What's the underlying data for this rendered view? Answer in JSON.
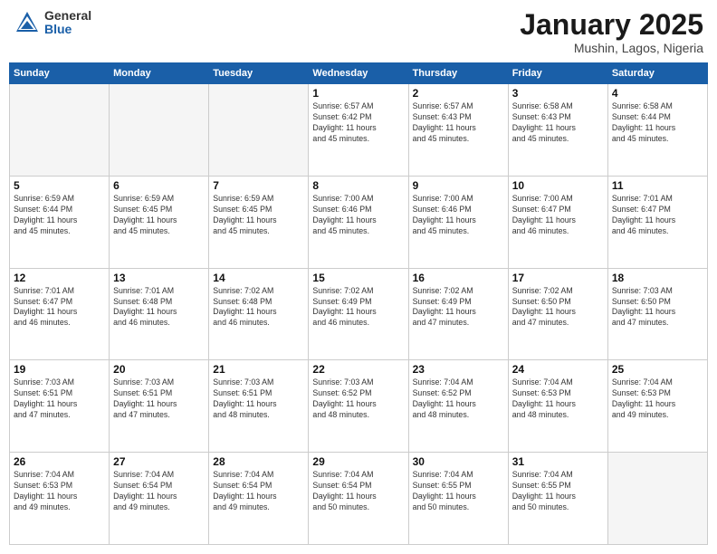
{
  "logo": {
    "general": "General",
    "blue": "Blue"
  },
  "title": "January 2025",
  "location": "Mushin, Lagos, Nigeria",
  "days_of_week": [
    "Sunday",
    "Monday",
    "Tuesday",
    "Wednesday",
    "Thursday",
    "Friday",
    "Saturday"
  ],
  "weeks": [
    [
      {
        "day": "",
        "info": ""
      },
      {
        "day": "",
        "info": ""
      },
      {
        "day": "",
        "info": ""
      },
      {
        "day": "1",
        "info": "Sunrise: 6:57 AM\nSunset: 6:42 PM\nDaylight: 11 hours\nand 45 minutes."
      },
      {
        "day": "2",
        "info": "Sunrise: 6:57 AM\nSunset: 6:43 PM\nDaylight: 11 hours\nand 45 minutes."
      },
      {
        "day": "3",
        "info": "Sunrise: 6:58 AM\nSunset: 6:43 PM\nDaylight: 11 hours\nand 45 minutes."
      },
      {
        "day": "4",
        "info": "Sunrise: 6:58 AM\nSunset: 6:44 PM\nDaylight: 11 hours\nand 45 minutes."
      }
    ],
    [
      {
        "day": "5",
        "info": "Sunrise: 6:59 AM\nSunset: 6:44 PM\nDaylight: 11 hours\nand 45 minutes."
      },
      {
        "day": "6",
        "info": "Sunrise: 6:59 AM\nSunset: 6:45 PM\nDaylight: 11 hours\nand 45 minutes."
      },
      {
        "day": "7",
        "info": "Sunrise: 6:59 AM\nSunset: 6:45 PM\nDaylight: 11 hours\nand 45 minutes."
      },
      {
        "day": "8",
        "info": "Sunrise: 7:00 AM\nSunset: 6:46 PM\nDaylight: 11 hours\nand 45 minutes."
      },
      {
        "day": "9",
        "info": "Sunrise: 7:00 AM\nSunset: 6:46 PM\nDaylight: 11 hours\nand 45 minutes."
      },
      {
        "day": "10",
        "info": "Sunrise: 7:00 AM\nSunset: 6:47 PM\nDaylight: 11 hours\nand 46 minutes."
      },
      {
        "day": "11",
        "info": "Sunrise: 7:01 AM\nSunset: 6:47 PM\nDaylight: 11 hours\nand 46 minutes."
      }
    ],
    [
      {
        "day": "12",
        "info": "Sunrise: 7:01 AM\nSunset: 6:47 PM\nDaylight: 11 hours\nand 46 minutes."
      },
      {
        "day": "13",
        "info": "Sunrise: 7:01 AM\nSunset: 6:48 PM\nDaylight: 11 hours\nand 46 minutes."
      },
      {
        "day": "14",
        "info": "Sunrise: 7:02 AM\nSunset: 6:48 PM\nDaylight: 11 hours\nand 46 minutes."
      },
      {
        "day": "15",
        "info": "Sunrise: 7:02 AM\nSunset: 6:49 PM\nDaylight: 11 hours\nand 46 minutes."
      },
      {
        "day": "16",
        "info": "Sunrise: 7:02 AM\nSunset: 6:49 PM\nDaylight: 11 hours\nand 47 minutes."
      },
      {
        "day": "17",
        "info": "Sunrise: 7:02 AM\nSunset: 6:50 PM\nDaylight: 11 hours\nand 47 minutes."
      },
      {
        "day": "18",
        "info": "Sunrise: 7:03 AM\nSunset: 6:50 PM\nDaylight: 11 hours\nand 47 minutes."
      }
    ],
    [
      {
        "day": "19",
        "info": "Sunrise: 7:03 AM\nSunset: 6:51 PM\nDaylight: 11 hours\nand 47 minutes."
      },
      {
        "day": "20",
        "info": "Sunrise: 7:03 AM\nSunset: 6:51 PM\nDaylight: 11 hours\nand 47 minutes."
      },
      {
        "day": "21",
        "info": "Sunrise: 7:03 AM\nSunset: 6:51 PM\nDaylight: 11 hours\nand 48 minutes."
      },
      {
        "day": "22",
        "info": "Sunrise: 7:03 AM\nSunset: 6:52 PM\nDaylight: 11 hours\nand 48 minutes."
      },
      {
        "day": "23",
        "info": "Sunrise: 7:04 AM\nSunset: 6:52 PM\nDaylight: 11 hours\nand 48 minutes."
      },
      {
        "day": "24",
        "info": "Sunrise: 7:04 AM\nSunset: 6:53 PM\nDaylight: 11 hours\nand 48 minutes."
      },
      {
        "day": "25",
        "info": "Sunrise: 7:04 AM\nSunset: 6:53 PM\nDaylight: 11 hours\nand 49 minutes."
      }
    ],
    [
      {
        "day": "26",
        "info": "Sunrise: 7:04 AM\nSunset: 6:53 PM\nDaylight: 11 hours\nand 49 minutes."
      },
      {
        "day": "27",
        "info": "Sunrise: 7:04 AM\nSunset: 6:54 PM\nDaylight: 11 hours\nand 49 minutes."
      },
      {
        "day": "28",
        "info": "Sunrise: 7:04 AM\nSunset: 6:54 PM\nDaylight: 11 hours\nand 49 minutes."
      },
      {
        "day": "29",
        "info": "Sunrise: 7:04 AM\nSunset: 6:54 PM\nDaylight: 11 hours\nand 50 minutes."
      },
      {
        "day": "30",
        "info": "Sunrise: 7:04 AM\nSunset: 6:55 PM\nDaylight: 11 hours\nand 50 minutes."
      },
      {
        "day": "31",
        "info": "Sunrise: 7:04 AM\nSunset: 6:55 PM\nDaylight: 11 hours\nand 50 minutes."
      },
      {
        "day": "",
        "info": ""
      }
    ]
  ]
}
